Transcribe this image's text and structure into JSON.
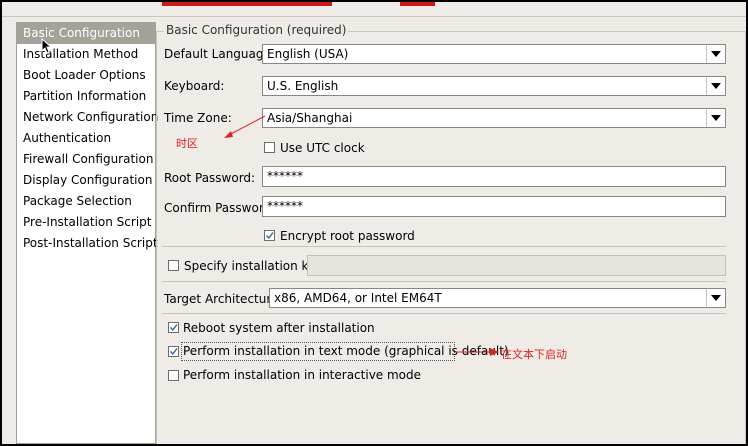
{
  "sidebar": {
    "items": [
      "Basic Configuration",
      "Installation Method",
      "Boot Loader Options",
      "Partition Information",
      "Network Configuration",
      "Authentication",
      "Firewall Configuration",
      "Display Configuration",
      "Package Selection",
      "Pre-Installation Script",
      "Post-Installation Script"
    ],
    "selected_index": 0
  },
  "basic": {
    "group_title": "Basic Configuration (required)",
    "language": {
      "label": "Default Language:",
      "value": "English (USA)"
    },
    "keyboard": {
      "label": "Keyboard:",
      "value": "U.S. English"
    },
    "timezone": {
      "label": "Time Zone:",
      "value": "Asia/Shanghai"
    },
    "utc": {
      "label": "Use UTC clock",
      "checked": false
    },
    "root_password": {
      "label": "Root Password:",
      "value": "******"
    },
    "confirm_password": {
      "label": "Confirm Password:",
      "value": "******"
    },
    "encrypt": {
      "label": "Encrypt root password",
      "checked": true
    },
    "install_key": {
      "label": "Specify installation key:",
      "checked": false,
      "value": ""
    },
    "arch": {
      "label": "Target Architecture:",
      "value": "x86, AMD64, or Intel EM64T"
    },
    "reboot": {
      "label": "Reboot system after installation",
      "checked": true
    },
    "text_mode": {
      "label": "Perform installation in text mode (graphical is default)",
      "checked": true
    },
    "interactive": {
      "label": "Perform installation in interactive mode",
      "checked": false
    }
  },
  "annotations": {
    "timezone_note": "时区",
    "textmode_note": "在文本下启动",
    "color": "#dd2222"
  }
}
